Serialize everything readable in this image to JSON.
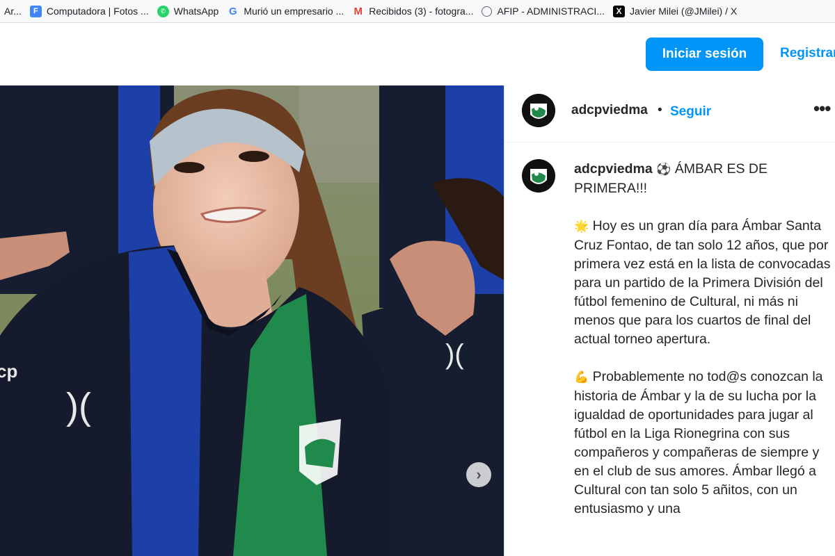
{
  "bookmarks": [
    {
      "label": "Ar...",
      "icon": "ar-icon"
    },
    {
      "label": "Computadora | Fotos ...",
      "icon": "forms-icon"
    },
    {
      "label": "WhatsApp",
      "icon": "whatsapp-icon"
    },
    {
      "label": "Murió un empresario ...",
      "icon": "google-icon"
    },
    {
      "label": "Recibidos (3) - fotogra...",
      "icon": "gmail-icon"
    },
    {
      "label": "AFIP - ADMINISTRACI...",
      "icon": "globe-icon"
    },
    {
      "label": "Javier Milei (@JMilei) / X",
      "icon": "x-icon"
    }
  ],
  "header": {
    "login_label": "Iniciar sesión",
    "register_label": "Registrar"
  },
  "post": {
    "username": "adcpviedma",
    "dot": "•",
    "follow_label": "Seguir",
    "more": "•••",
    "caption": {
      "username": "adcpviedma",
      "title_emoji": "⚽",
      "title": " ÁMBAR ES DE PRIMERA!!!",
      "p1_emoji": "🌟",
      "p1": " Hoy es un gran día para Ámbar Santa Cruz Fontao, de tan solo 12 años, que por primera vez está en la lista de convocadas para un partido de la Primera División del fútbol femenino de Cultural, ni más ni menos que para los cuartos de final del actual torneo apertura.",
      "p2_emoji": "💪",
      "p2": " Probablemente no tod@s conozcan la historia de Ámbar y la de su lucha por la igualdad de oportunidades para jugar al fútbol en la Liga Rionegrina con sus compañeros y compañeras de siempre y en el club de sus amores. Ámbar llegó a Cultural con tan solo 5 añitos, con un entusiasmo y una"
    }
  },
  "colors": {
    "accent": "#0095f6",
    "jersey_blue": "#1d3fa8",
    "jersey_green": "#1f8a4c",
    "jersey_navy": "#151b2c"
  }
}
